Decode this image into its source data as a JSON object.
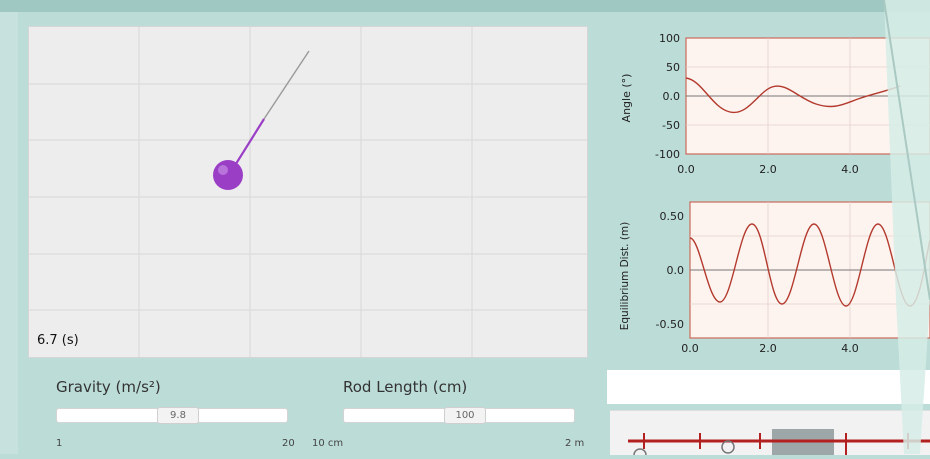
{
  "simulation": {
    "time_readout": "6.7 (s)"
  },
  "controls": {
    "gravity": {
      "label": "Gravity (m/s²)",
      "value": "9.8",
      "min_label": "1",
      "max_label": "20"
    },
    "rod_length": {
      "label": "Rod Length (cm)",
      "value": "100",
      "min_label": "10 cm",
      "max_label": "2 m"
    }
  },
  "graphs": {
    "angle": {
      "ylabel": "Angle (°)",
      "y_ticks": [
        "100",
        "50",
        "0.0",
        "-50",
        "-100"
      ],
      "x_ticks": [
        "0.0",
        "2.0",
        "4.0"
      ]
    },
    "distance": {
      "ylabel": "Equilibrium Dist. (m)",
      "y_ticks": [
        "0.50",
        "0.0",
        "-0.50"
      ],
      "x_ticks": [
        "0.0",
        "2.0",
        "4.0"
      ]
    }
  },
  "colors": {
    "pendulum": "#9b3ec6",
    "curve": "#b33a2d",
    "background": "#bcdcd7"
  }
}
